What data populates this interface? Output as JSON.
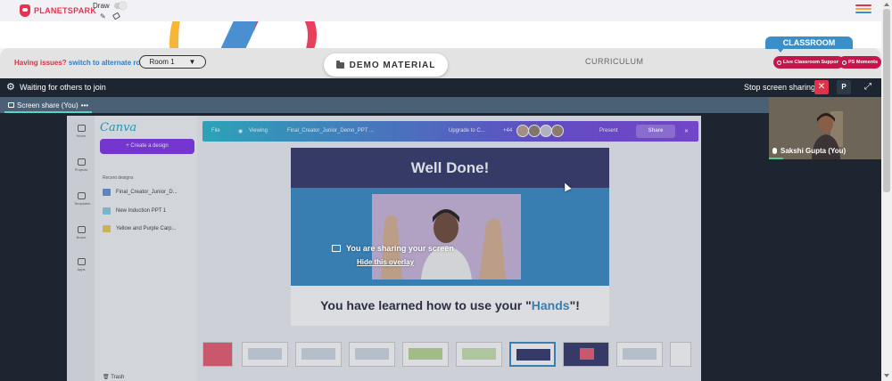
{
  "brand": {
    "logo_text": "PLANETSPARK",
    "accent": "#e8314f"
  },
  "toolbar": {
    "draw_label": "Draw",
    "draw_enabled": false,
    "pencil_icon": "pencil-icon",
    "eraser_icon": "eraser-icon",
    "menu_icon": "hamburger-menu-icon"
  },
  "controls": {
    "issues_text": "Having issues?",
    "switch_link": "switch to alternate room",
    "room_selected": "Room 1",
    "demo_tab": "DEMO MATERIAL",
    "curriculum_tab": "CURRICULUM",
    "classroom_tab": "CLASSROOM",
    "live_support": "Live Classroom Support",
    "ps_moments": "PS Moments"
  },
  "meeting": {
    "status": "Waiting for others to join",
    "stop_sharing": "Stop screen sharing",
    "p_button": "P",
    "share_tab": "Screen share (You)",
    "share_tab_menu": "•••",
    "participant_name": "Sakshi Gupta (You)"
  },
  "shared_screen": {
    "app_logo": "Canva",
    "create_button": "+ Create a design",
    "recent_label": "Recent designs",
    "recent_items": [
      "Final_Creator_Junior_D...",
      "New Induction PPT 1",
      "Yellow and Purple Carp..."
    ],
    "nav_items": [
      "Home",
      "Projects",
      "Templates",
      "Brand",
      "Apps"
    ],
    "trash_label": "Trash",
    "top_file": "File",
    "top_viewing": "Viewing",
    "top_filename": "Final_Creator_Junior_Demo_PPT ...",
    "top_upgrade": "Upgrade to C...",
    "top_count": "+44",
    "top_present": "Present",
    "top_share": "Share",
    "slide_title": "Well Done!",
    "slide_text_before": "You have learned how to use your \"",
    "slide_text_highlight": "Hands",
    "slide_text_after": "\"!",
    "overlay_message": "You are sharing your screen",
    "overlay_link": "Hide this overlay"
  },
  "colors": {
    "classroom": "#3b8fc8",
    "pill": "#c4164b",
    "stop_red": "#e0324a",
    "meeting_bg": "#1c2530"
  }
}
